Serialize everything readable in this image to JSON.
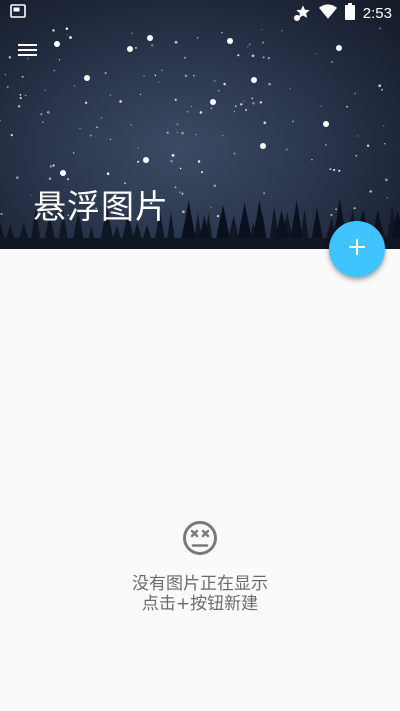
{
  "status_bar": {
    "time": "2:53",
    "left_icon": "screenshot-icon",
    "right_icons": [
      "star-icon",
      "wifi-icon",
      "battery-icon"
    ]
  },
  "header": {
    "title": "悬浮图片",
    "menu_icon": "menu-icon",
    "background_colors": [
      "#141b29",
      "#3b4a63"
    ]
  },
  "fab": {
    "icon": "plus-icon",
    "color": "#40c4ff"
  },
  "empty_state": {
    "icon": "sad-face-icon",
    "line1": "没有图片正在显示",
    "line2": "点击+按钮新建"
  }
}
